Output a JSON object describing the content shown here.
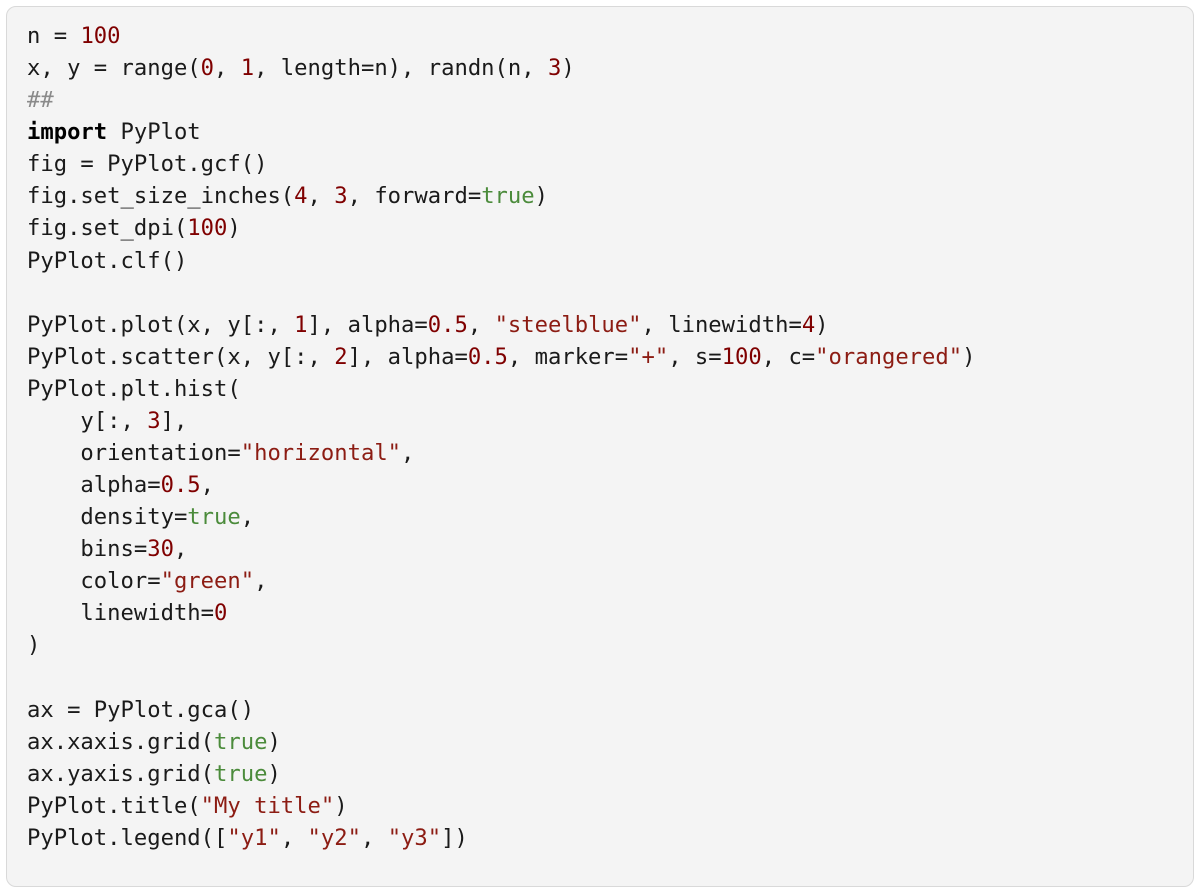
{
  "code": {
    "tokens": [
      {
        "t": "n = "
      },
      {
        "t": "100",
        "c": "tok-num"
      },
      {
        "t": "\n"
      },
      {
        "t": "x, y = range("
      },
      {
        "t": "0",
        "c": "tok-num"
      },
      {
        "t": ", "
      },
      {
        "t": "1",
        "c": "tok-num"
      },
      {
        "t": ", length=n), randn(n, "
      },
      {
        "t": "3",
        "c": "tok-num"
      },
      {
        "t": ")\n"
      },
      {
        "t": "##",
        "c": "tok-com"
      },
      {
        "t": "\n"
      },
      {
        "t": "import",
        "c": "tok-key"
      },
      {
        "t": " PyPlot\n"
      },
      {
        "t": "fig = PyPlot.gcf()\n"
      },
      {
        "t": "fig.set_size_inches("
      },
      {
        "t": "4",
        "c": "tok-num"
      },
      {
        "t": ", "
      },
      {
        "t": "3",
        "c": "tok-num"
      },
      {
        "t": ", forward="
      },
      {
        "t": "true",
        "c": "tok-bool"
      },
      {
        "t": ")\n"
      },
      {
        "t": "fig.set_dpi("
      },
      {
        "t": "100",
        "c": "tok-num"
      },
      {
        "t": ")\n"
      },
      {
        "t": "PyPlot.clf()\n"
      },
      {
        "t": "\n"
      },
      {
        "t": "PyPlot.plot(x, y[:, "
      },
      {
        "t": "1",
        "c": "tok-num"
      },
      {
        "t": "], alpha="
      },
      {
        "t": "0.5",
        "c": "tok-num"
      },
      {
        "t": ", "
      },
      {
        "t": "\"steelblue\"",
        "c": "tok-str"
      },
      {
        "t": ", linewidth="
      },
      {
        "t": "4",
        "c": "tok-num"
      },
      {
        "t": ")\n"
      },
      {
        "t": "PyPlot.scatter(x, y[:, "
      },
      {
        "t": "2",
        "c": "tok-num"
      },
      {
        "t": "], alpha="
      },
      {
        "t": "0.5",
        "c": "tok-num"
      },
      {
        "t": ", marker="
      },
      {
        "t": "\"+\"",
        "c": "tok-str"
      },
      {
        "t": ", s="
      },
      {
        "t": "100",
        "c": "tok-num"
      },
      {
        "t": ", c="
      },
      {
        "t": "\"orangered\"",
        "c": "tok-str"
      },
      {
        "t": ")\n"
      },
      {
        "t": "PyPlot.plt.hist(\n"
      },
      {
        "t": "    y[:, "
      },
      {
        "t": "3",
        "c": "tok-num"
      },
      {
        "t": "],\n"
      },
      {
        "t": "    orientation="
      },
      {
        "t": "\"horizontal\"",
        "c": "tok-str"
      },
      {
        "t": ",\n"
      },
      {
        "t": "    alpha="
      },
      {
        "t": "0.5",
        "c": "tok-num"
      },
      {
        "t": ",\n"
      },
      {
        "t": "    density="
      },
      {
        "t": "true",
        "c": "tok-bool"
      },
      {
        "t": ",\n"
      },
      {
        "t": "    bins="
      },
      {
        "t": "30",
        "c": "tok-num"
      },
      {
        "t": ",\n"
      },
      {
        "t": "    color="
      },
      {
        "t": "\"green\"",
        "c": "tok-str"
      },
      {
        "t": ",\n"
      },
      {
        "t": "    linewidth="
      },
      {
        "t": "0",
        "c": "tok-num"
      },
      {
        "t": "\n"
      },
      {
        "t": ")\n"
      },
      {
        "t": "\n"
      },
      {
        "t": "ax = PyPlot.gca()\n"
      },
      {
        "t": "ax.xaxis.grid("
      },
      {
        "t": "true",
        "c": "tok-bool"
      },
      {
        "t": ")\n"
      },
      {
        "t": "ax.yaxis.grid("
      },
      {
        "t": "true",
        "c": "tok-bool"
      },
      {
        "t": ")\n"
      },
      {
        "t": "PyPlot.title("
      },
      {
        "t": "\"My title\"",
        "c": "tok-str"
      },
      {
        "t": ")\n"
      },
      {
        "t": "PyPlot.legend(["
      },
      {
        "t": "\"y1\"",
        "c": "tok-str"
      },
      {
        "t": ", "
      },
      {
        "t": "\"y2\"",
        "c": "tok-str"
      },
      {
        "t": ", "
      },
      {
        "t": "\"y3\"",
        "c": "tok-str"
      },
      {
        "t": "])"
      }
    ]
  }
}
